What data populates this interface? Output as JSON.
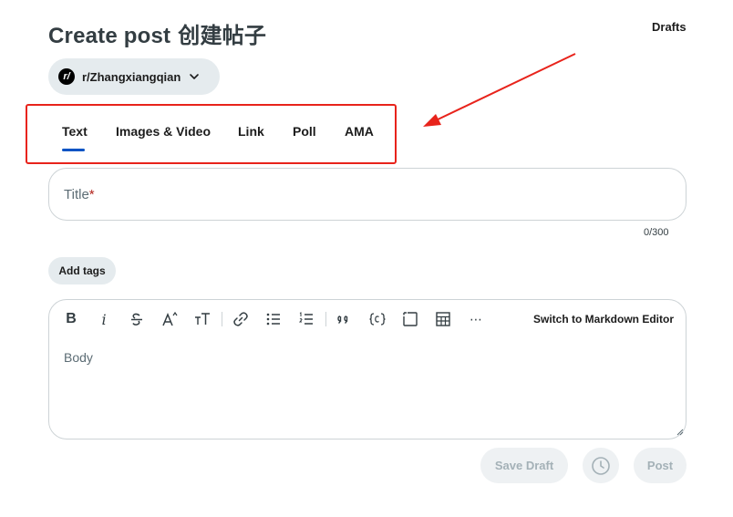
{
  "header": {
    "title": "Create post",
    "title_chinese": "创建帖子",
    "drafts_label": "Drafts"
  },
  "community": {
    "avatar_text": "r/",
    "name": "r/Zhangxiangqian"
  },
  "tabs": [
    {
      "label": "Text",
      "selected": true
    },
    {
      "label": "Images & Video",
      "selected": false
    },
    {
      "label": "Link",
      "selected": false
    },
    {
      "label": "Poll",
      "selected": false
    },
    {
      "label": "AMA",
      "selected": false
    }
  ],
  "title_field": {
    "placeholder": "Title",
    "required_mark": "*",
    "counter": "0/300"
  },
  "tags": {
    "add_label": "Add tags"
  },
  "editor": {
    "toolbar": {
      "bold": "B",
      "italic": "i",
      "overflow": "⋯",
      "switch_label": "Switch to Markdown Editor"
    },
    "body_placeholder": "Body"
  },
  "actions": {
    "save_draft_label": "Save Draft",
    "post_label": "Post"
  },
  "colors": {
    "accent_underline": "#0a54c4",
    "annotation_red": "#e8231b",
    "pill_bg": "#e5ebee",
    "disabled_text": "#a4b1b7"
  }
}
